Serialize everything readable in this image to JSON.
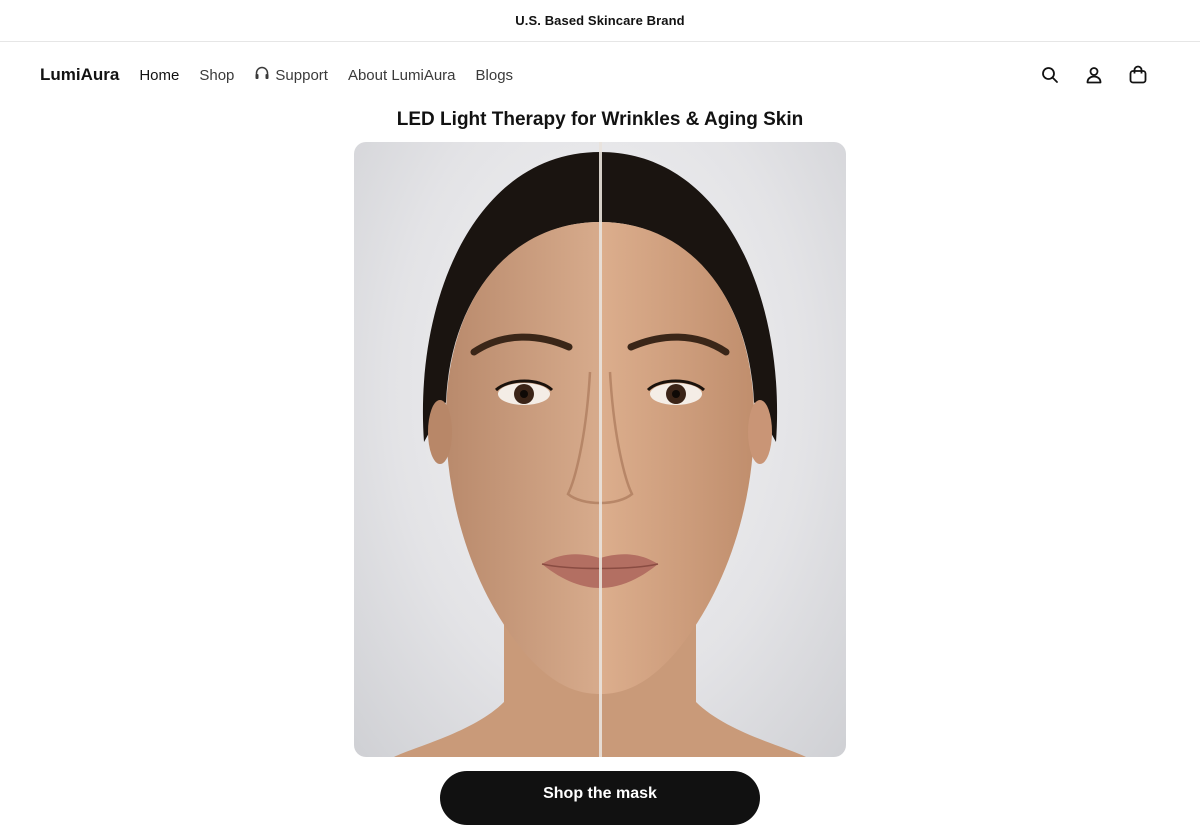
{
  "announcement": {
    "text": "U.S. Based Skincare Brand"
  },
  "header": {
    "logo": "LumiAura",
    "nav": [
      {
        "label": "Home"
      },
      {
        "label": "Shop"
      },
      {
        "label": "Support",
        "icon": "headphones-icon"
      },
      {
        "label": "About LumiAura"
      },
      {
        "label": "Blogs"
      }
    ],
    "icons": [
      "search-icon",
      "account-icon",
      "cart-icon"
    ]
  },
  "hero": {
    "title": "LED Light Therapy for Wrinkles & Aging Skin",
    "cta_label": "Shop the mask"
  },
  "colors": {
    "text": "#121212",
    "button_bg": "#111111",
    "button_text": "#ffffff"
  }
}
